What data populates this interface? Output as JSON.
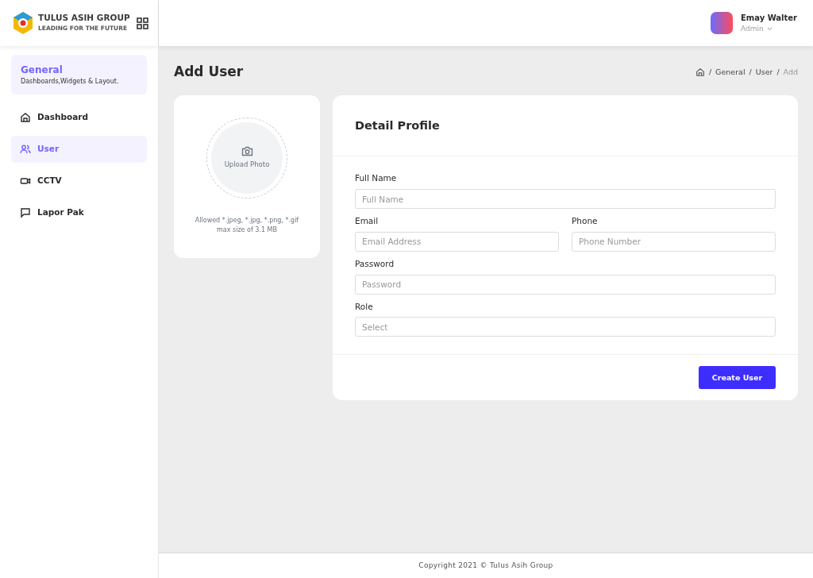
{
  "brand": {
    "name": "TULUS ASIH GROUP",
    "tagline": "LEADING FOR THE FUTURE"
  },
  "user": {
    "name": "Emay Walter",
    "role": "Admin"
  },
  "sidebar": {
    "section": {
      "title": "General",
      "subtitle": "Dashboards,Widgets & Layout."
    },
    "items": [
      {
        "label": "Dashboard",
        "selected": false
      },
      {
        "label": "User",
        "selected": true
      },
      {
        "label": "CCTV",
        "selected": false
      },
      {
        "label": "Lapor Pak",
        "selected": false
      }
    ]
  },
  "page_title": "Add User",
  "breadcrumb": [
    "General",
    "User",
    "Add"
  ],
  "breadcrumb_separator": "/",
  "upload": {
    "label": "Upload Photo",
    "hint_lines": [
      "Allowed *.jpeg, *.jpg, *.png, *.gif",
      "max size of 3.1 MB"
    ]
  },
  "form": {
    "title": "Detail Profile",
    "rows": [
      [
        {
          "label": "Full Name",
          "placeholder": "Full Name"
        }
      ],
      [
        {
          "label": "Email",
          "placeholder": "Email Address"
        },
        {
          "label": "Phone",
          "placeholder": "Phone Number"
        }
      ],
      [
        {
          "label": "Password",
          "placeholder": "Password"
        }
      ],
      [
        {
          "label": "Role",
          "placeholder": "Select"
        }
      ]
    ],
    "submit": "Create User"
  },
  "footer": "Copyright 2021 © Tulus Asih Group"
}
